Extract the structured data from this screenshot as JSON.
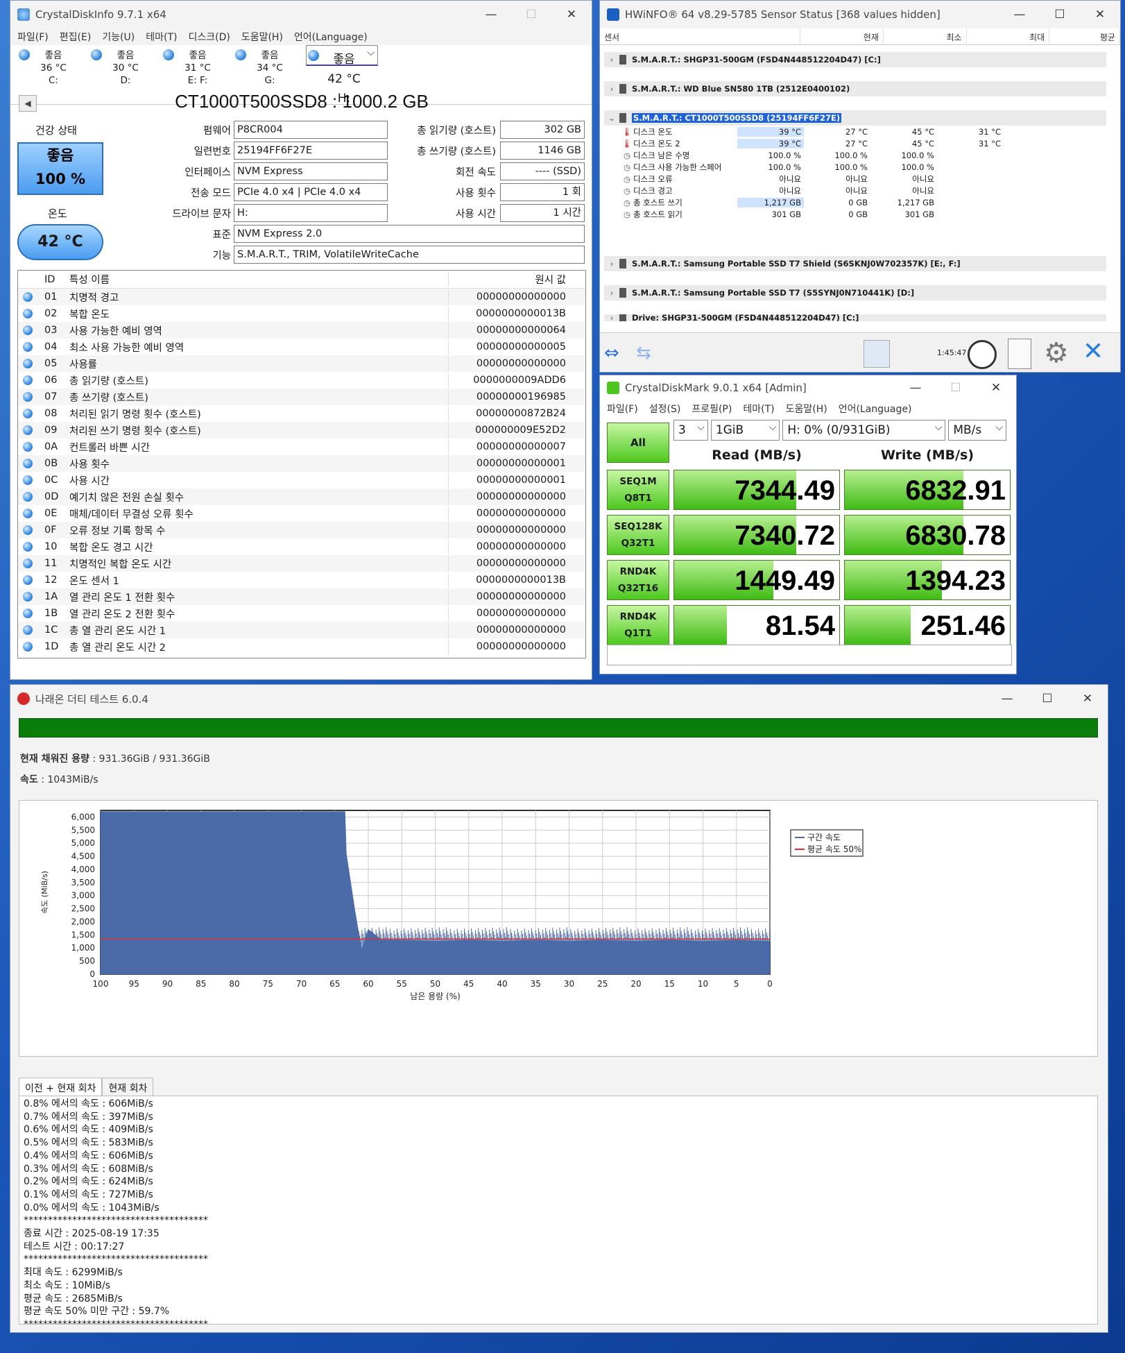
{
  "cdi": {
    "title": "CrystalDiskInfo 9.7.1 x64",
    "menu": [
      "파일(F)",
      "편집(E)",
      "기능(U)",
      "테마(T)",
      "디스크(D)",
      "도움말(H)",
      "언어(Language)"
    ],
    "drives": [
      {
        "status": "좋음",
        "temp": "36 °C",
        "letter": "C:"
      },
      {
        "status": "좋음",
        "temp": "30 °C",
        "letter": "D:"
      },
      {
        "status": "좋음",
        "temp": "31 °C",
        "letter": "E: F:"
      },
      {
        "status": "좋음",
        "temp": "34 °C",
        "letter": "G:"
      },
      {
        "status": "좋음",
        "temp": "42 °C",
        "letter": "H:"
      }
    ],
    "model": "CT1000T500SSD8 : 1000.2 GB",
    "health_label": "건강 상태",
    "health_status": "좋음",
    "health_pct": "100 %",
    "temp_label": "온도",
    "temp_value": "42 °C",
    "left_fields": [
      {
        "k": "펌웨어",
        "v": "P8CR004"
      },
      {
        "k": "일련번호",
        "v": "25194FF6F27E"
      },
      {
        "k": "인터페이스",
        "v": "NVM Express"
      },
      {
        "k": "전송 모드",
        "v": "PCIe 4.0 x4 | PCIe 4.0 x4"
      },
      {
        "k": "드라이브 문자",
        "v": "H:"
      }
    ],
    "right_fields": [
      {
        "k": "총 읽기량 (호스트)",
        "v": "302 GB"
      },
      {
        "k": "총 쓰기량 (호스트)",
        "v": "1146 GB"
      },
      {
        "k": "회전 속도",
        "v": "---- (SSD)"
      },
      {
        "k": "사용 횟수",
        "v": "1 회"
      },
      {
        "k": "사용 시간",
        "v": "1 시간"
      }
    ],
    "standard_label": "표준",
    "standard": "NVM Express 2.0",
    "features_label": "기능",
    "features": "S.M.A.R.T., TRIM, VolatileWriteCache",
    "smart_headers": {
      "id": "ID",
      "name": "특성 이름",
      "raw": "원시 값"
    },
    "smart": [
      {
        "id": "01",
        "name": "치명적 경고",
        "raw": "00000000000000"
      },
      {
        "id": "02",
        "name": "복합 온도",
        "raw": "0000000000013B"
      },
      {
        "id": "03",
        "name": "사용 가능한 예비 영역",
        "raw": "00000000000064"
      },
      {
        "id": "04",
        "name": "최소 사용 가능한 예비 영역",
        "raw": "00000000000005"
      },
      {
        "id": "05",
        "name": "사용률",
        "raw": "00000000000000"
      },
      {
        "id": "06",
        "name": "총 읽기량 (호스트)",
        "raw": "0000000009ADD6"
      },
      {
        "id": "07",
        "name": "총 쓰기량 (호스트)",
        "raw": "00000000196985"
      },
      {
        "id": "08",
        "name": "처리된 읽기 명령 횟수 (호스트)",
        "raw": "00000000872B24"
      },
      {
        "id": "09",
        "name": "처리된 쓰기 명령 횟수 (호스트)",
        "raw": "000000009E52D2"
      },
      {
        "id": "0A",
        "name": "컨트롤러 바쁜 시간",
        "raw": "00000000000007"
      },
      {
        "id": "0B",
        "name": "사용 횟수",
        "raw": "00000000000001"
      },
      {
        "id": "0C",
        "name": "사용 시간",
        "raw": "00000000000001"
      },
      {
        "id": "0D",
        "name": "예기치 않은 전원 손실 횟수",
        "raw": "00000000000000"
      },
      {
        "id": "0E",
        "name": "매체/데이터 무결성 오류 횟수",
        "raw": "00000000000000"
      },
      {
        "id": "0F",
        "name": "오류 정보 기록 항목 수",
        "raw": "00000000000000"
      },
      {
        "id": "10",
        "name": "복합 온도 경고 시간",
        "raw": "00000000000000"
      },
      {
        "id": "11",
        "name": "치명적인 복합 온도 시간",
        "raw": "00000000000000"
      },
      {
        "id": "12",
        "name": "온도 센서 1",
        "raw": "0000000000013B"
      },
      {
        "id": "1A",
        "name": "열 관리 온도 1 전환 횟수",
        "raw": "00000000000000"
      },
      {
        "id": "1B",
        "name": "열 관리 온도 2 전환 횟수",
        "raw": "00000000000000"
      },
      {
        "id": "1C",
        "name": "총 열 관리 온도 시간 1",
        "raw": "00000000000000"
      },
      {
        "id": "1D",
        "name": "총 열 관리 온도 시간 2",
        "raw": "00000000000000"
      }
    ]
  },
  "hw": {
    "title": "HWiNFO® 64 v8.29-5785 Sensor Status [368 values hidden]",
    "headers": {
      "sensor": "센서",
      "cur": "현재",
      "min": "최소",
      "max": "최대",
      "avg": "평균"
    },
    "groups": [
      "S.M.A.R.T.: SHGP31-500GM (FSD4N448512204D47) [C:]",
      "S.M.A.R.T.: WD Blue SN580 1TB (2512E0400102)",
      "S.M.A.R.T.: CT1000T500SSD8 (25194FF6F27E)",
      "S.M.A.R.T.: Samsung Portable SSD T7 Shield (S6SKNJ0W702357K) [E:, F:]",
      "S.M.A.R.T.: Samsung Portable SSD T7 (S5SYNJ0N710441K) [D:]",
      "Drive: SHGP31-500GM (FSD4N448512204D47) [C:]"
    ],
    "rows": [
      {
        "name": "디스크 온도",
        "icon": "thermometer",
        "cur": "39 °C",
        "min": "27 °C",
        "max": "45 °C",
        "avg": "31 °C"
      },
      {
        "name": "디스크 온도 2",
        "icon": "thermometer",
        "cur": "39 °C",
        "min": "27 °C",
        "max": "45 °C",
        "avg": "31 °C"
      },
      {
        "name": "디스크 남은 수명",
        "icon": "clock",
        "cur": "100.0 %",
        "min": "100.0 %",
        "max": "100.0 %",
        "avg": ""
      },
      {
        "name": "디스크 사용 가능한 스페어",
        "icon": "clock",
        "cur": "100.0 %",
        "min": "100.0 %",
        "max": "100.0 %",
        "avg": ""
      },
      {
        "name": "디스크 오류",
        "icon": "clock",
        "cur": "아니요",
        "min": "아니요",
        "max": "아니요",
        "avg": ""
      },
      {
        "name": "디스크 경고",
        "icon": "clock",
        "cur": "아니요",
        "min": "아니요",
        "max": "아니요",
        "avg": ""
      },
      {
        "name": "총 호스트 쓰기",
        "icon": "clock",
        "cur": "1,217 GB",
        "min": "0 GB",
        "max": "1,217 GB",
        "avg": ""
      },
      {
        "name": "총 호스트 읽기",
        "icon": "clock",
        "cur": "301 GB",
        "min": "0 GB",
        "max": "301 GB",
        "avg": ""
      }
    ],
    "timer": "1:45:47"
  },
  "cdm": {
    "title": "CrystalDiskMark 9.0.1 x64 [Admin]",
    "menu": [
      "파일(F)",
      "설정(S)",
      "프로필(P)",
      "테마(T)",
      "도움말(H)",
      "언어(Language)"
    ],
    "all": "All",
    "count": "3",
    "size": "1GiB",
    "drive": "H: 0% (0/931GiB)",
    "unit": "MB/s",
    "read_hdr": "Read (MB/s)",
    "write_hdr": "Write (MB/s)",
    "tests": [
      {
        "l1": "SEQ1M",
        "l2": "Q8T1",
        "read": "7344.49",
        "write": "6832.91",
        "read_fill": 0.74,
        "write_fill": 0.72
      },
      {
        "l1": "SEQ128K",
        "l2": "Q32T1",
        "read": "7340.72",
        "write": "6830.78",
        "read_fill": 0.74,
        "write_fill": 0.72
      },
      {
        "l1": "RND4K",
        "l2": "Q32T16",
        "read": "1449.49",
        "write": "1394.23",
        "read_fill": 0.6,
        "write_fill": 0.59
      },
      {
        "l1": "RND4K",
        "l2": "Q1T1",
        "read": "81.54",
        "write": "251.46",
        "read_fill": 0.32,
        "write_fill": 0.4
      }
    ]
  },
  "dt": {
    "title": "나래온 더티 테스트 6.0.4",
    "filled_label": "현재 채워진 용량",
    "filled": "931.36GiB / 931.36GiB",
    "speed_label": "속도",
    "speed": "1043MiB/s",
    "tabs": [
      "이전 + 현재 회차",
      "현재 회차"
    ],
    "log": [
      "0.8% 에서의 속도 : 606MiB/s",
      "0.7% 에서의 속도 : 397MiB/s",
      "0.6% 에서의 속도 : 409MiB/s",
      "0.5% 에서의 속도 : 583MiB/s",
      "0.4% 에서의 속도 : 606MiB/s",
      "0.3% 에서의 속도 : 608MiB/s",
      "0.2% 에서의 속도 : 624MiB/s",
      "0.1% 에서의 속도 : 727MiB/s",
      "0.0% 에서의 속도 : 1043MiB/s",
      "**************************************",
      "종료 시간 : 2025-08-19 17:35",
      "테스트 시간 : 00:17:27",
      "**************************************",
      "최대 속도 : 6299MiB/s",
      "최소 속도 : 10MiB/s",
      "평균 속도 : 2685MiB/s",
      "평균 속도 50% 미만 구간 : 59.7%",
      "**************************************"
    ]
  },
  "chart_data": {
    "type": "area",
    "xlabel": "남은 용량 (%)",
    "ylabel": "속도 (MiB/s)",
    "xlim": [
      100,
      0
    ],
    "ylim": [
      0,
      6250
    ],
    "x_ticks": [
      100,
      95,
      90,
      85,
      80,
      75,
      70,
      65,
      60,
      55,
      50,
      45,
      40,
      35,
      30,
      25,
      20,
      15,
      10,
      5,
      0
    ],
    "y_ticks": [
      0,
      500,
      1000,
      1500,
      2000,
      2500,
      3000,
      3500,
      4000,
      4500,
      5000,
      5500,
      6000
    ],
    "y_tick_labels": [
      "0",
      "500",
      "1,000",
      "1,500",
      "2,000",
      "2,500",
      "3,000",
      "3,500",
      "4,000",
      "4,500",
      "5,000",
      "5,500",
      "6,000"
    ],
    "legend_position": "top-right",
    "grid": true,
    "series": [
      {
        "name": "구간 속도",
        "color": "#4a6aa8",
        "x": [
          100,
          63.5,
          63.3,
          62,
          61,
          60,
          58,
          55,
          50,
          45,
          40,
          35,
          30,
          25,
          20,
          15,
          10,
          5,
          0
        ],
        "y": [
          6200,
          6200,
          4600,
          2400,
          900,
          1700,
          1300,
          1300,
          1250,
          1300,
          1250,
          1300,
          1250,
          1300,
          1250,
          1300,
          1250,
          1300,
          1250
        ]
      },
      {
        "name": "평균 속도 50%",
        "color": "#e03030",
        "x": [
          100,
          0
        ],
        "y": [
          1342,
          1342
        ]
      }
    ]
  }
}
